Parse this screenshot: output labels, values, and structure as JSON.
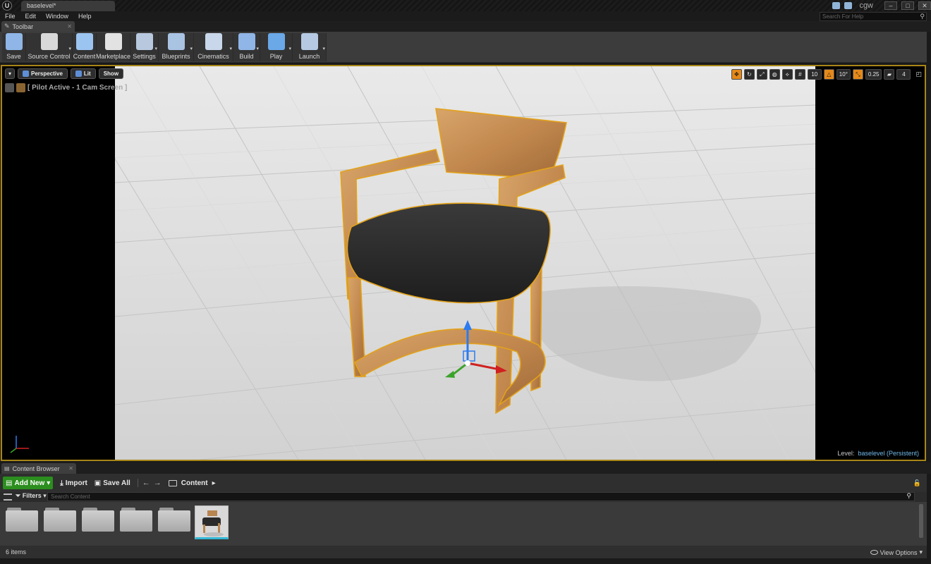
{
  "window": {
    "document_tab": "baselevel*",
    "user": "cgw",
    "controls": [
      "–",
      "□",
      "✕"
    ]
  },
  "menu": [
    "File",
    "Edit",
    "Window",
    "Help"
  ],
  "help_search": {
    "placeholder": "Search For Help"
  },
  "toolbar_tab": {
    "label": "Toolbar"
  },
  "toolbar": {
    "buttons": [
      {
        "label": "Save",
        "icon": "save-icon",
        "color": "#8fb6e6",
        "dropdown": false
      },
      {
        "label": "Source Control",
        "icon": "source-control-icon",
        "color": "#d9d9d9",
        "dropdown": true
      },
      {
        "label": "Content",
        "icon": "content-icon",
        "color": "#9cc4f0",
        "dropdown": false
      },
      {
        "label": "Marketplace",
        "icon": "marketplace-icon",
        "color": "#e2e2e2",
        "dropdown": false
      },
      {
        "label": "Settings",
        "icon": "settings-icon",
        "color": "#b8c8de",
        "dropdown": true
      },
      {
        "label": "Blueprints",
        "icon": "blueprints-icon",
        "color": "#a9c3e3",
        "dropdown": true
      },
      {
        "label": "Cinematics",
        "icon": "cinematics-icon",
        "color": "#c9d7ea",
        "dropdown": true
      },
      {
        "label": "Build",
        "icon": "build-icon",
        "color": "#8fb6e6",
        "dropdown": true
      },
      {
        "label": "Play",
        "icon": "play-icon",
        "color": "#6aa8e8",
        "dropdown": true
      },
      {
        "label": "Launch",
        "icon": "launch-icon",
        "color": "#b5c9e2",
        "dropdown": true
      }
    ]
  },
  "viewport": {
    "view_mode": "Perspective",
    "lighting": "Lit",
    "show": "Show",
    "pilot_text": "[ Pilot Active - 1 Cam Screen ]",
    "grid_snap": "10",
    "rotation_snap": "10°",
    "scale_snap": "0.25",
    "camera_speed": "4",
    "level_label": "Level:",
    "level_name": "baselevel (Persistent)",
    "accent_color": "#e5891a",
    "selection_outline": "#e3a21a"
  },
  "content_browser": {
    "tab_label": "Content Browser",
    "add_new": "Add New",
    "import": "Import",
    "save_all": "Save All",
    "path_root": "Content",
    "filters": "Filters",
    "search_placeholder": "Search Content",
    "item_count": "6 items",
    "view_options": "View Options",
    "assets": [
      {
        "kind": "folder"
      },
      {
        "kind": "folder"
      },
      {
        "kind": "folder"
      },
      {
        "kind": "folder"
      },
      {
        "kind": "folder"
      },
      {
        "kind": "static-mesh",
        "thumbnail": "chair-thumbnail"
      }
    ]
  }
}
